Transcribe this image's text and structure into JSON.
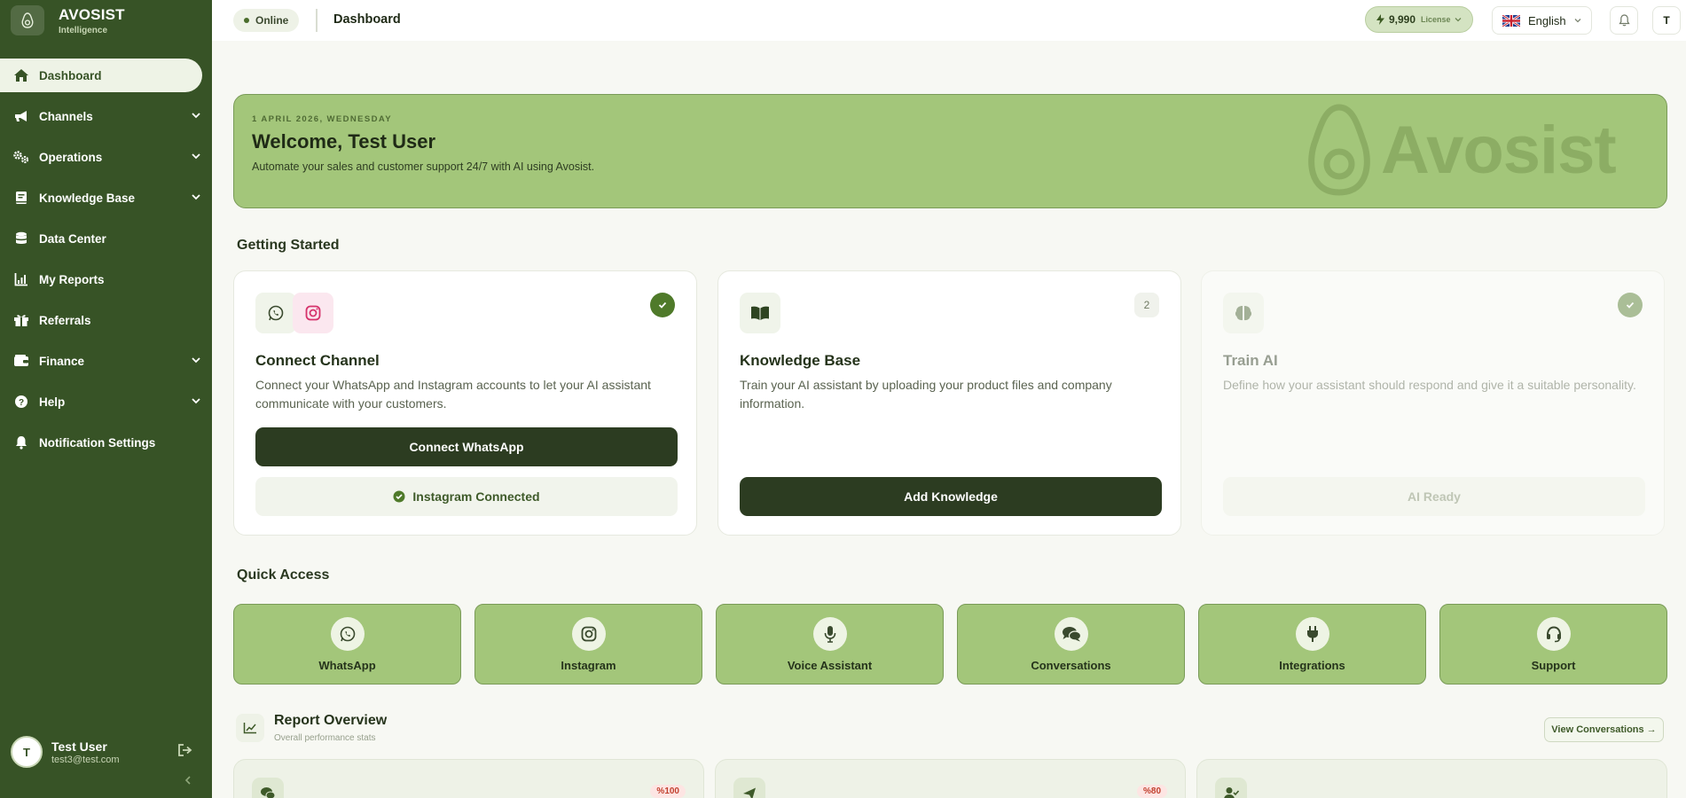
{
  "brand": {
    "name": "AVOSIST",
    "sub": "Intelligence"
  },
  "sidebar": {
    "items": [
      {
        "label": "Dashboard",
        "icon": "home-icon"
      },
      {
        "label": "Channels",
        "icon": "megaphone-icon"
      },
      {
        "label": "Operations",
        "icon": "gears-icon"
      },
      {
        "label": "Knowledge Base",
        "icon": "book-icon"
      },
      {
        "label": "Data Center",
        "icon": "database-icon"
      },
      {
        "label": "My Reports",
        "icon": "chart-icon"
      },
      {
        "label": "Referrals",
        "icon": "gift-icon"
      },
      {
        "label": "Finance",
        "icon": "wallet-icon"
      },
      {
        "label": "Help",
        "icon": "question-icon"
      },
      {
        "label": "Notification Settings",
        "icon": "bell-icon"
      }
    ],
    "user": {
      "initial": "T",
      "name": "Test User",
      "email": "test3@test.com"
    }
  },
  "topbar": {
    "status": "Online",
    "title": "Dashboard",
    "license_value": "9,990",
    "license_label": "License",
    "language": "English",
    "user_initial": "T"
  },
  "welcome": {
    "date": "1 APRIL 2026, WEDNESDAY",
    "title": "Welcome, Test User",
    "subtitle": "Automate your sales and customer support 24/7 with AI using Avosist.",
    "watermark": "Avosist"
  },
  "getting_started": {
    "title": "Getting Started",
    "cards": [
      {
        "title": "Connect Channel",
        "desc": "Connect your WhatsApp and Instagram accounts to let your AI assistant communicate with your customers.",
        "primary": "Connect WhatsApp",
        "secondary": "Instagram Connected"
      },
      {
        "title": "Knowledge Base",
        "desc": "Train your AI assistant by uploading your product files and company information.",
        "badge": "2",
        "primary": "Add Knowledge"
      },
      {
        "title": "Train AI",
        "desc": "Define how your assistant should respond and give it a suitable personality.",
        "secondary": "AI Ready"
      }
    ]
  },
  "quick_access": {
    "title": "Quick Access",
    "items": [
      "WhatsApp",
      "Instagram",
      "Voice Assistant",
      "Conversations",
      "Integrations",
      "Support"
    ]
  },
  "report_overview": {
    "title": "Report Overview",
    "subtitle": "Overall performance stats",
    "button": "View Conversations →",
    "cards": [
      {
        "pct": "%100"
      },
      {
        "pct": "%80"
      },
      {
        "pct": ""
      }
    ]
  },
  "colors": {
    "sidebar": "#375326",
    "accent_green": "#a3c67a",
    "dark_button": "#2c3c21"
  }
}
